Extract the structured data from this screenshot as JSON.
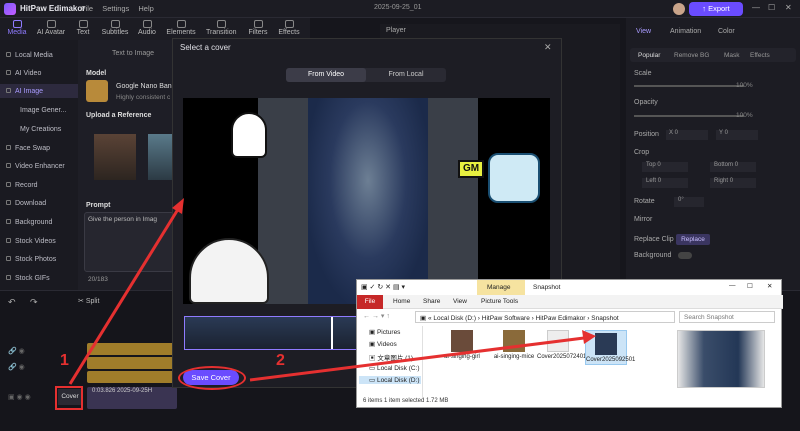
{
  "app": {
    "title": "HitPaw Edimakor",
    "menu": [
      "File",
      "Settings",
      "Help"
    ],
    "project": "2025-09-25_01",
    "export_label": "Export"
  },
  "toolbar": {
    "items": [
      "Media",
      "AI Avatar",
      "Text",
      "Subtitles",
      "Audio",
      "Elements",
      "Transition",
      "Filters",
      "Effects"
    ]
  },
  "leftnav": {
    "items": [
      "Local Media",
      "AI Video",
      "AI Image",
      "Image Gener...",
      "My Creations",
      "Face Swap",
      "Video Enhancer",
      "Record",
      "Download",
      "Background",
      "Stock Videos",
      "Stock Photos",
      "Stock GIFs"
    ]
  },
  "midpanel": {
    "tab": "Text to Image",
    "model_heading": "Model",
    "model_name": "Google Nano Ban",
    "model_desc": "Highly consistent c",
    "upload_heading": "Upload a Reference",
    "prompt_heading": "Prompt",
    "prompt_text": "Give the person in Imag",
    "credits": "20/183"
  },
  "player": {
    "label": "Player"
  },
  "rightpanel": {
    "tabs": [
      "View",
      "Animation",
      "Color"
    ],
    "subtabs": [
      "Popular",
      "Remove BG",
      "Mask",
      "Effects"
    ],
    "scale_label": "Scale",
    "scale_value": "100%",
    "opacity_label": "Opacity",
    "opacity_value": "100%",
    "position_label": "Position",
    "position_x": "0",
    "position_y": "0",
    "crop_label": "Crop",
    "crop_top": "Top",
    "crop_bottom": "Bottom",
    "crop_left": "Left",
    "crop_right": "Right",
    "crop_value": "0",
    "rotate_label": "Rotate",
    "rotate_value": "0°",
    "mirror_label": "Mirror",
    "replace_label": "Replace Clip",
    "replace_button": "Replace",
    "background_label": "Background"
  },
  "timeline": {
    "split_label": "Split",
    "cover_label": "Cover",
    "clip_time": "0:03.826 2025-09-25H"
  },
  "modal": {
    "title": "Select a cover",
    "tab_video": "From Video",
    "tab_local": "From Local",
    "save_button": "Save Cover",
    "gm_text": "GM"
  },
  "explorer": {
    "tabs": {
      "file": "File",
      "home": "Home",
      "share": "Share",
      "view": "View",
      "picture_tools": "Picture Tools",
      "manage": "Manage"
    },
    "window_title": "Snapshot",
    "path": [
      "Local Disk (D:)",
      "HitPaw Software",
      "HitPaw Edimakor",
      "Snapshot"
    ],
    "search_placeholder": "Search Snapshot",
    "sidebar": [
      "Pictures",
      "Videos",
      "文章图片 (1)",
      "Local Disk (C:)",
      "Local Disk (D:)"
    ],
    "files": [
      {
        "name": "ai-singing-girl"
      },
      {
        "name": "ai-singing-mice"
      },
      {
        "name": "Cover2025072401"
      },
      {
        "name": "Cover2025092501"
      }
    ],
    "status": "6 items    1 item selected  1.72 MB"
  },
  "annotations": {
    "step1": "1",
    "step2": "2"
  },
  "colors": {
    "accent": "#6a4cff",
    "annotation": "#e53030"
  }
}
